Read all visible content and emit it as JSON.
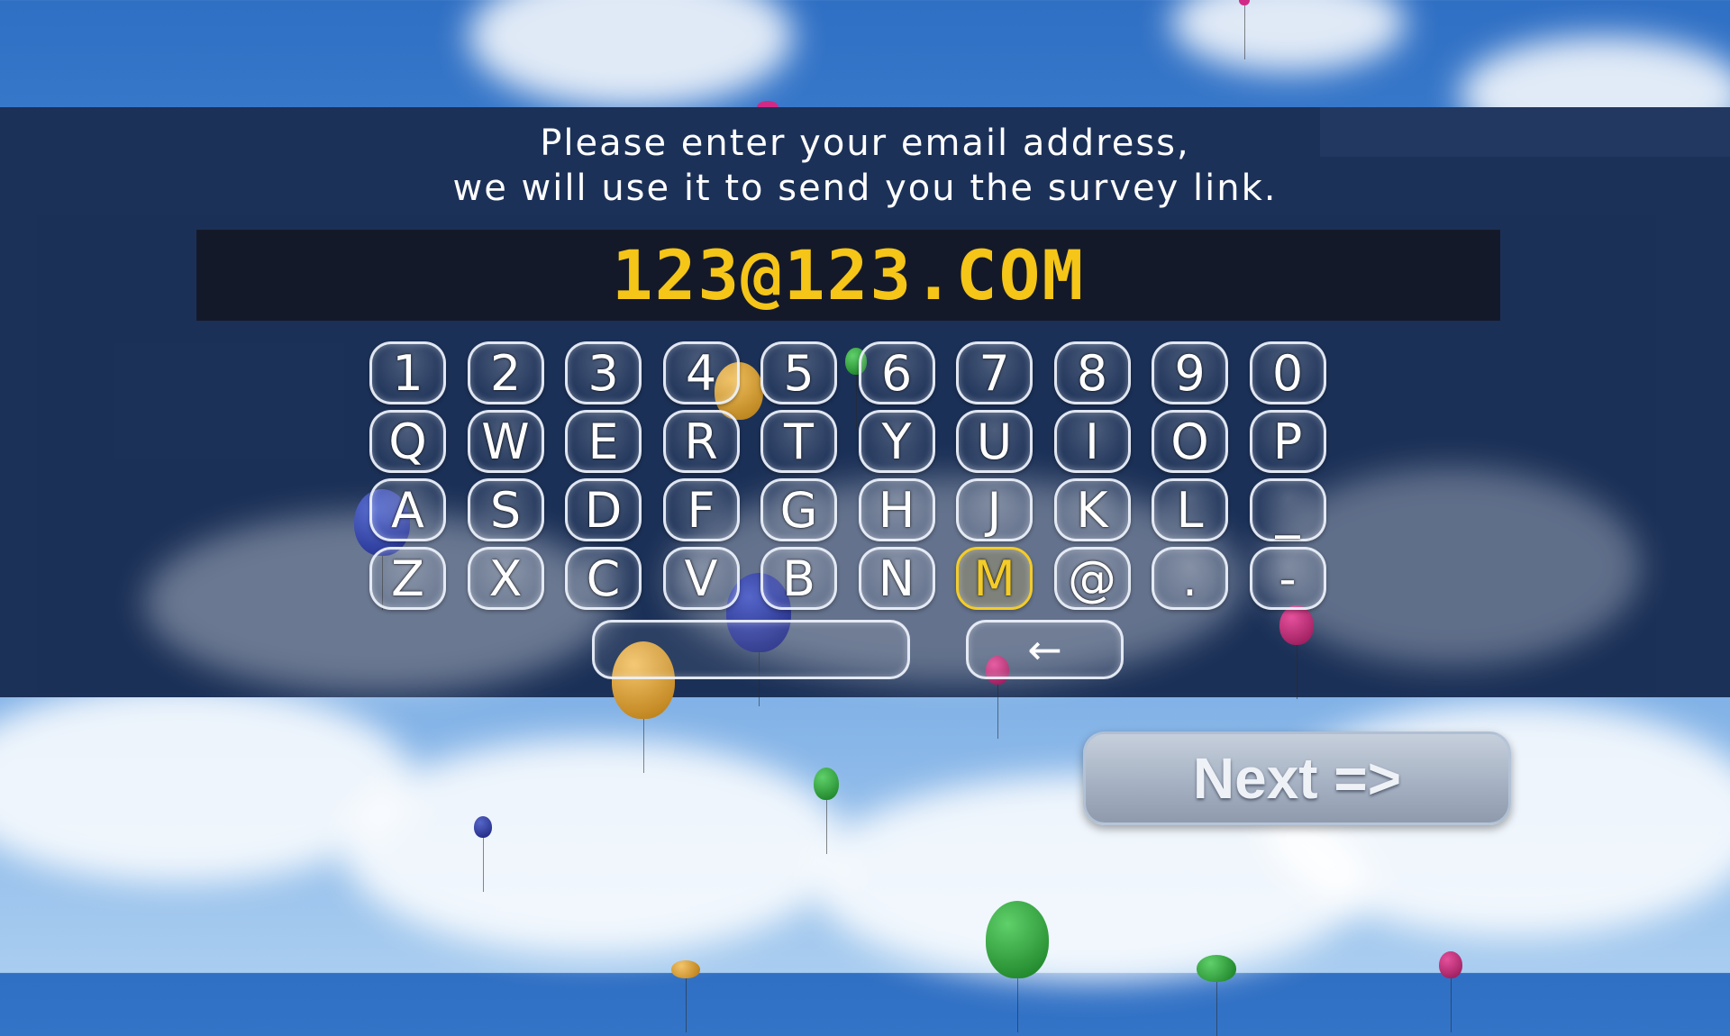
{
  "prompt": {
    "line1": "Please enter your email address,",
    "line2": "we will use it to send you the survey link."
  },
  "email": {
    "value": "123@123.COM"
  },
  "keyboard": {
    "rows": [
      [
        "1",
        "2",
        "3",
        "4",
        "5",
        "6",
        "7",
        "8",
        "9",
        "0"
      ],
      [
        "Q",
        "W",
        "E",
        "R",
        "T",
        "Y",
        "U",
        "I",
        "O",
        "P"
      ],
      [
        "A",
        "S",
        "D",
        "F",
        "G",
        "H",
        "J",
        "K",
        "L",
        "_"
      ],
      [
        "Z",
        "X",
        "C",
        "V",
        "B",
        "N",
        "M",
        "@",
        ".",
        "-"
      ]
    ],
    "highlighted_key": "M",
    "space_label": "",
    "backspace_label": "←"
  },
  "next_button": {
    "label": "Next =>"
  },
  "colors": {
    "email_text": "#f5c518",
    "highlight": "#f3cc2a",
    "panel": "#1c3158"
  },
  "icons": {
    "backspace": "left-arrow-icon"
  }
}
